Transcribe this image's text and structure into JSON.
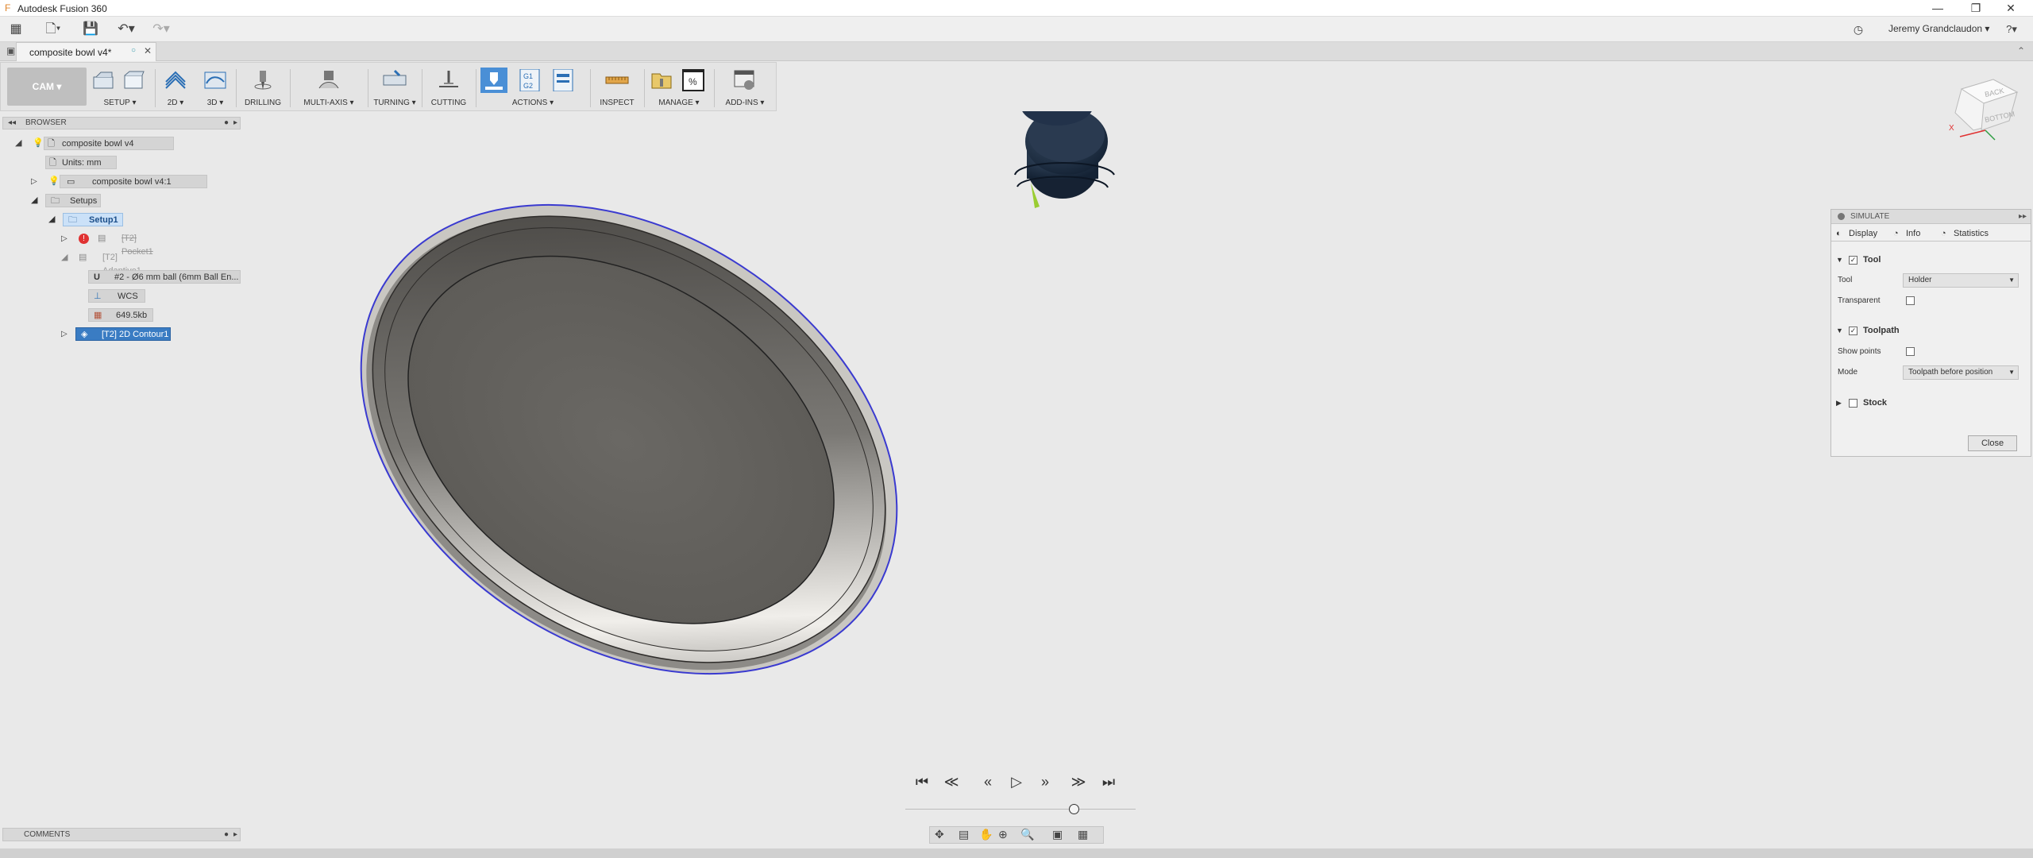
{
  "app": {
    "title": "Autodesk Fusion 360"
  },
  "window": {
    "minimize": "—",
    "restore": "❐",
    "close": "✕"
  },
  "quickbar": {
    "user": "Jeremy Grandclaudon ▾",
    "help": "?▾"
  },
  "document_tab": {
    "label": "composite bowl v4*"
  },
  "toolbar": {
    "workspace": "CAM ▾",
    "groups": {
      "setup": "SETUP ▾",
      "twod": "2D ▾",
      "threed": "3D ▾",
      "drilling": "DRILLING",
      "multiaxis": "MULTI-AXIS ▾",
      "turning": "TURNING ▾",
      "cutting": "CUTTING",
      "actions": "ACTIONS ▾",
      "inspect": "INSPECT",
      "manage": "MANAGE ▾",
      "addins": "ADD-INS ▾"
    }
  },
  "browser": {
    "header": "BROWSER",
    "root": "composite bowl v4",
    "units": "Units: mm",
    "component": "composite bowl v4:1",
    "setups": "Setups",
    "setup1": "Setup1",
    "pocket": "[T2] Pocket1",
    "adaptive": "[T2] Adaptive1",
    "tool": "#2 - Ø6 mm ball (6mm Ball En...",
    "wcs": "WCS",
    "size": "649.5kb",
    "contour": "[T2] 2D Contour1"
  },
  "viewcube": {
    "back": "BACK",
    "bottom": "BOTTOM",
    "axis_x": "X"
  },
  "simulate": {
    "header": "SIMULATE",
    "tabs": {
      "display": "Display",
      "info": "Info",
      "statistics": "Statistics"
    },
    "tool_section": "Tool",
    "tool_label": "Tool",
    "tool_value": "Holder",
    "transparent_label": "Transparent",
    "toolpath_section": "Toolpath",
    "show_points_label": "Show points",
    "mode_label": "Mode",
    "mode_value": "Toolpath before position",
    "stock_section": "Stock",
    "close": "Close"
  },
  "comments": {
    "label": "COMMENTS"
  },
  "playback": {
    "first": "⏮",
    "prev_op": "≪",
    "step_back": "«",
    "play": "▷",
    "step_fwd": "»",
    "next_op": "≫",
    "last": "⏭"
  }
}
